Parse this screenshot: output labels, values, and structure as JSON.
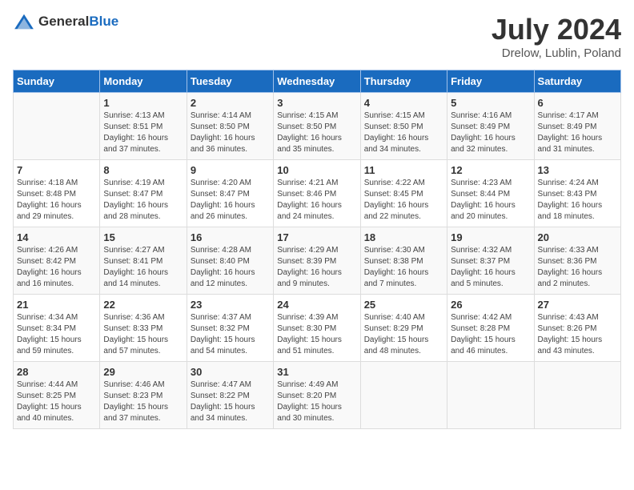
{
  "header": {
    "logo_general": "General",
    "logo_blue": "Blue",
    "month": "July 2024",
    "location": "Drelow, Lublin, Poland"
  },
  "days_of_week": [
    "Sunday",
    "Monday",
    "Tuesday",
    "Wednesday",
    "Thursday",
    "Friday",
    "Saturday"
  ],
  "weeks": [
    [
      {
        "day": "",
        "info": ""
      },
      {
        "day": "1",
        "info": "Sunrise: 4:13 AM\nSunset: 8:51 PM\nDaylight: 16 hours and 37 minutes."
      },
      {
        "day": "2",
        "info": "Sunrise: 4:14 AM\nSunset: 8:50 PM\nDaylight: 16 hours and 36 minutes."
      },
      {
        "day": "3",
        "info": "Sunrise: 4:15 AM\nSunset: 8:50 PM\nDaylight: 16 hours and 35 minutes."
      },
      {
        "day": "4",
        "info": "Sunrise: 4:15 AM\nSunset: 8:50 PM\nDaylight: 16 hours and 34 minutes."
      },
      {
        "day": "5",
        "info": "Sunrise: 4:16 AM\nSunset: 8:49 PM\nDaylight: 16 hours and 32 minutes."
      },
      {
        "day": "6",
        "info": "Sunrise: 4:17 AM\nSunset: 8:49 PM\nDaylight: 16 hours and 31 minutes."
      }
    ],
    [
      {
        "day": "7",
        "info": "Sunrise: 4:18 AM\nSunset: 8:48 PM\nDaylight: 16 hours and 29 minutes."
      },
      {
        "day": "8",
        "info": "Sunrise: 4:19 AM\nSunset: 8:47 PM\nDaylight: 16 hours and 28 minutes."
      },
      {
        "day": "9",
        "info": "Sunrise: 4:20 AM\nSunset: 8:47 PM\nDaylight: 16 hours and 26 minutes."
      },
      {
        "day": "10",
        "info": "Sunrise: 4:21 AM\nSunset: 8:46 PM\nDaylight: 16 hours and 24 minutes."
      },
      {
        "day": "11",
        "info": "Sunrise: 4:22 AM\nSunset: 8:45 PM\nDaylight: 16 hours and 22 minutes."
      },
      {
        "day": "12",
        "info": "Sunrise: 4:23 AM\nSunset: 8:44 PM\nDaylight: 16 hours and 20 minutes."
      },
      {
        "day": "13",
        "info": "Sunrise: 4:24 AM\nSunset: 8:43 PM\nDaylight: 16 hours and 18 minutes."
      }
    ],
    [
      {
        "day": "14",
        "info": "Sunrise: 4:26 AM\nSunset: 8:42 PM\nDaylight: 16 hours and 16 minutes."
      },
      {
        "day": "15",
        "info": "Sunrise: 4:27 AM\nSunset: 8:41 PM\nDaylight: 16 hours and 14 minutes."
      },
      {
        "day": "16",
        "info": "Sunrise: 4:28 AM\nSunset: 8:40 PM\nDaylight: 16 hours and 12 minutes."
      },
      {
        "day": "17",
        "info": "Sunrise: 4:29 AM\nSunset: 8:39 PM\nDaylight: 16 hours and 9 minutes."
      },
      {
        "day": "18",
        "info": "Sunrise: 4:30 AM\nSunset: 8:38 PM\nDaylight: 16 hours and 7 minutes."
      },
      {
        "day": "19",
        "info": "Sunrise: 4:32 AM\nSunset: 8:37 PM\nDaylight: 16 hours and 5 minutes."
      },
      {
        "day": "20",
        "info": "Sunrise: 4:33 AM\nSunset: 8:36 PM\nDaylight: 16 hours and 2 minutes."
      }
    ],
    [
      {
        "day": "21",
        "info": "Sunrise: 4:34 AM\nSunset: 8:34 PM\nDaylight: 15 hours and 59 minutes."
      },
      {
        "day": "22",
        "info": "Sunrise: 4:36 AM\nSunset: 8:33 PM\nDaylight: 15 hours and 57 minutes."
      },
      {
        "day": "23",
        "info": "Sunrise: 4:37 AM\nSunset: 8:32 PM\nDaylight: 15 hours and 54 minutes."
      },
      {
        "day": "24",
        "info": "Sunrise: 4:39 AM\nSunset: 8:30 PM\nDaylight: 15 hours and 51 minutes."
      },
      {
        "day": "25",
        "info": "Sunrise: 4:40 AM\nSunset: 8:29 PM\nDaylight: 15 hours and 48 minutes."
      },
      {
        "day": "26",
        "info": "Sunrise: 4:42 AM\nSunset: 8:28 PM\nDaylight: 15 hours and 46 minutes."
      },
      {
        "day": "27",
        "info": "Sunrise: 4:43 AM\nSunset: 8:26 PM\nDaylight: 15 hours and 43 minutes."
      }
    ],
    [
      {
        "day": "28",
        "info": "Sunrise: 4:44 AM\nSunset: 8:25 PM\nDaylight: 15 hours and 40 minutes."
      },
      {
        "day": "29",
        "info": "Sunrise: 4:46 AM\nSunset: 8:23 PM\nDaylight: 15 hours and 37 minutes."
      },
      {
        "day": "30",
        "info": "Sunrise: 4:47 AM\nSunset: 8:22 PM\nDaylight: 15 hours and 34 minutes."
      },
      {
        "day": "31",
        "info": "Sunrise: 4:49 AM\nSunset: 8:20 PM\nDaylight: 15 hours and 30 minutes."
      },
      {
        "day": "",
        "info": ""
      },
      {
        "day": "",
        "info": ""
      },
      {
        "day": "",
        "info": ""
      }
    ]
  ]
}
